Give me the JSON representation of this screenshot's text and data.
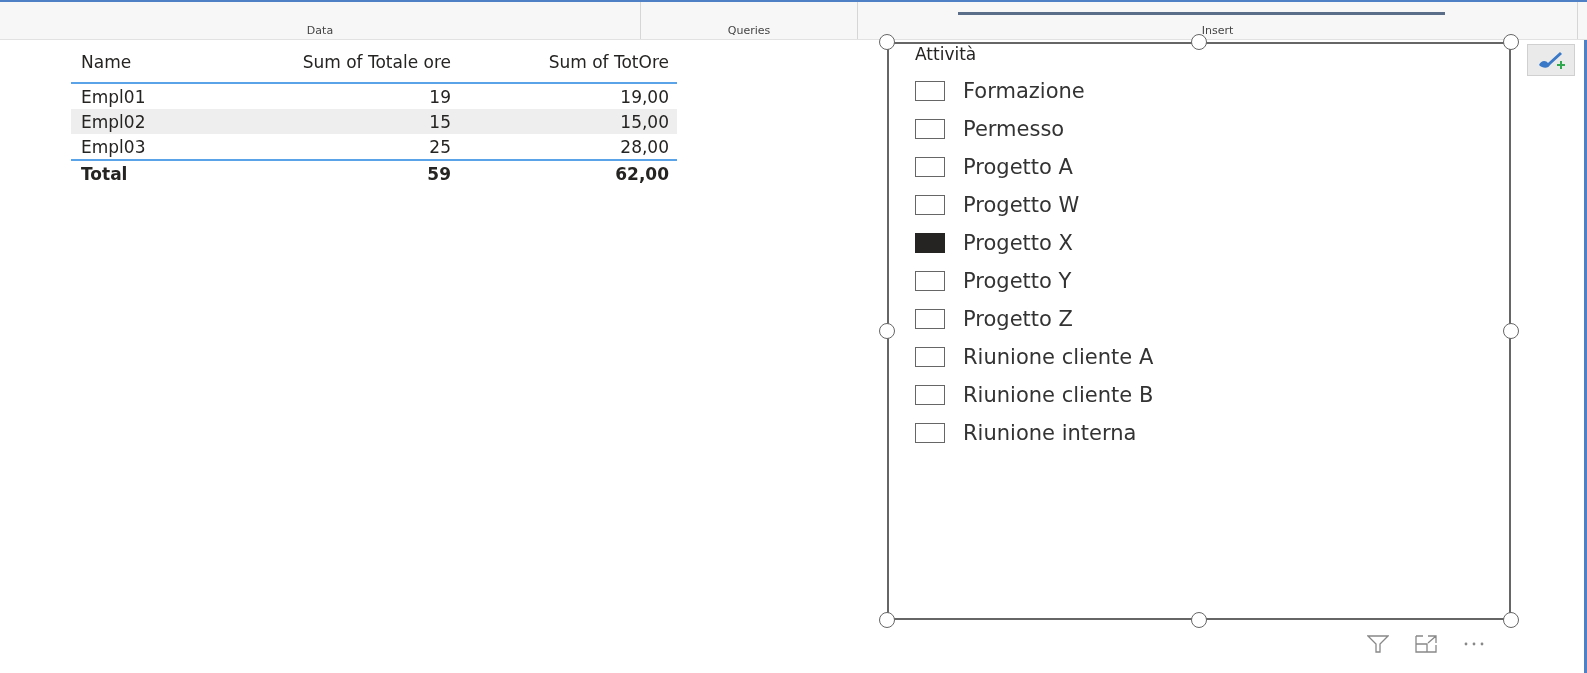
{
  "ribbon": {
    "groups": [
      {
        "label": "Data"
      },
      {
        "label": "Queries"
      },
      {
        "label": "Insert"
      }
    ]
  },
  "table": {
    "columns": [
      "Name",
      "Sum of Totale ore",
      "Sum of TotOre"
    ],
    "rows": [
      {
        "cells": [
          "Empl01",
          "19",
          "19,00"
        ],
        "selected": false
      },
      {
        "cells": [
          "Empl02",
          "15",
          "15,00"
        ],
        "selected": true
      },
      {
        "cells": [
          "Empl03",
          "25",
          "28,00"
        ],
        "selected": false
      }
    ],
    "total": [
      "Total",
      "59",
      "62,00"
    ]
  },
  "slicer": {
    "title": "Attività",
    "items": [
      {
        "label": "Formazione",
        "checked": false
      },
      {
        "label": "Permesso",
        "checked": false
      },
      {
        "label": "Progetto A",
        "checked": false
      },
      {
        "label": "Progetto W",
        "checked": false
      },
      {
        "label": "Progetto X",
        "checked": true
      },
      {
        "label": "Progetto Y",
        "checked": false
      },
      {
        "label": "Progetto Z",
        "checked": false
      },
      {
        "label": "Riunione cliente A",
        "checked": false
      },
      {
        "label": "Riunione cliente B",
        "checked": false
      },
      {
        "label": "Riunione interna",
        "checked": false
      }
    ]
  }
}
